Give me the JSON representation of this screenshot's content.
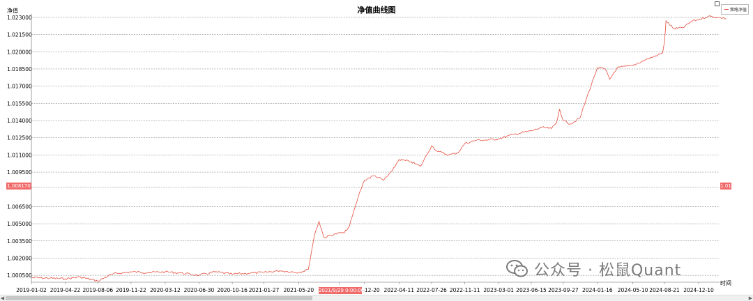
{
  "chart_data": {
    "type": "line",
    "title": "净值曲线图",
    "ylabel": "净值",
    "xlabel": "时间",
    "ylim": [
      0.9999,
      1.0233
    ],
    "y_ticks": [
      "1.023000",
      "1.021500",
      "1.020000",
      "1.018500",
      "1.017000",
      "1.015500",
      "1.014000",
      "1.012500",
      "1.011000",
      "1.009500",
      "1.008170",
      "1.006500",
      "1.005000",
      "1.003500",
      "1.002000",
      "1.000500"
    ],
    "x_ticks": [
      "2019-01-02",
      "2019-04-22",
      "2019-08-06",
      "2019-11-22",
      "2020-03-12",
      "2020-06-30",
      "2020-10-16",
      "2021-01-27",
      "2021-05-20",
      "2021-09-29",
      "2021-12-20",
      "2022-04-11",
      "2022-07-26",
      "2022-11-11",
      "2023-03-01",
      "2023-06-15",
      "2023-09-27",
      "2024-01-16",
      "2024-05-10",
      "2024-08-21",
      "2024-12-10"
    ],
    "grid": true,
    "legend": "top-right",
    "series": [
      {
        "name": "策略净值",
        "color": "#e74c3c",
        "points": [
          [
            "2019-01-02",
            1.0003
          ],
          [
            "2019-04-22",
            1.0002
          ],
          [
            "2019-06-10",
            1.00035
          ],
          [
            "2019-08-06",
            1.0
          ],
          [
            "2019-09-20",
            1.0006
          ],
          [
            "2019-11-22",
            1.0008
          ],
          [
            "2020-01-15",
            1.00075
          ],
          [
            "2020-03-12",
            1.0008
          ],
          [
            "2020-05-01",
            1.0007
          ],
          [
            "2020-06-30",
            1.0005
          ],
          [
            "2020-08-20",
            1.0008
          ],
          [
            "2020-10-16",
            1.0006
          ],
          [
            "2020-12-15",
            1.0007
          ],
          [
            "2021-01-27",
            1.00075
          ],
          [
            "2021-03-20",
            1.0009
          ],
          [
            "2021-05-20",
            1.00075
          ],
          [
            "2021-06-20",
            1.001
          ],
          [
            "2021-07-10",
            1.004
          ],
          [
            "2021-07-25",
            1.0052
          ],
          [
            "2021-08-10",
            1.0038
          ],
          [
            "2021-09-29",
            1.0042
          ],
          [
            "2021-10-15",
            1.0042
          ],
          [
            "2021-11-01",
            1.0048
          ],
          [
            "2021-11-20",
            1.0065
          ],
          [
            "2021-12-05",
            1.0078
          ],
          [
            "2021-12-20",
            1.0088
          ],
          [
            "2022-01-20",
            1.0092
          ],
          [
            "2022-02-20",
            1.0088
          ],
          [
            "2022-03-20",
            1.0096
          ],
          [
            "2022-04-11",
            1.0106
          ],
          [
            "2022-05-20",
            1.0104
          ],
          [
            "2022-06-20",
            1.01
          ],
          [
            "2022-07-10",
            1.011
          ],
          [
            "2022-07-26",
            1.0118
          ],
          [
            "2022-08-15",
            1.0113
          ],
          [
            "2022-09-20",
            1.011
          ],
          [
            "2022-10-20",
            1.0112
          ],
          [
            "2022-11-11",
            1.012
          ],
          [
            "2022-12-20",
            1.0123
          ],
          [
            "2023-01-20",
            1.0123
          ],
          [
            "2023-03-01",
            1.0124
          ],
          [
            "2023-04-20",
            1.0128
          ],
          [
            "2023-06-15",
            1.0131
          ],
          [
            "2023-07-20",
            1.0134
          ],
          [
            "2023-08-20",
            1.0133
          ],
          [
            "2023-09-05",
            1.0138
          ],
          [
            "2023-09-15",
            1.015
          ],
          [
            "2023-09-27",
            1.014
          ],
          [
            "2023-10-20",
            1.0137
          ],
          [
            "2023-11-20",
            1.0142
          ],
          [
            "2023-12-10",
            1.0158
          ],
          [
            "2024-01-05",
            1.0178
          ],
          [
            "2024-01-16",
            1.0186
          ],
          [
            "2024-02-10",
            1.0185
          ],
          [
            "2024-02-25",
            1.0176
          ],
          [
            "2024-03-20",
            1.0186
          ],
          [
            "2024-05-10",
            1.0188
          ],
          [
            "2024-06-20",
            1.0193
          ],
          [
            "2024-07-20",
            1.0196
          ],
          [
            "2024-08-15",
            1.0199
          ],
          [
            "2024-08-21",
            1.0208
          ],
          [
            "2024-08-26",
            1.0227
          ],
          [
            "2024-09-20",
            1.022
          ],
          [
            "2024-10-20",
            1.0221
          ],
          [
            "2024-11-20",
            1.0227
          ],
          [
            "2024-12-10",
            1.0228
          ],
          [
            "2025-01-10",
            1.0231
          ],
          [
            "2025-02-10",
            1.023
          ],
          [
            "2025-03-10",
            1.0229
          ]
        ]
      }
    ],
    "cursor": {
      "y_value": "1.008170",
      "y_value_right": "1.01",
      "x_value": "2021/9/29 0:00:00"
    }
  },
  "watermark": {
    "text": "公众号 · 松鼠Quant",
    "icon": "wechat-icon"
  },
  "scrollbar": {
    "left_arrow": "◀",
    "right_arrow": "▶"
  }
}
